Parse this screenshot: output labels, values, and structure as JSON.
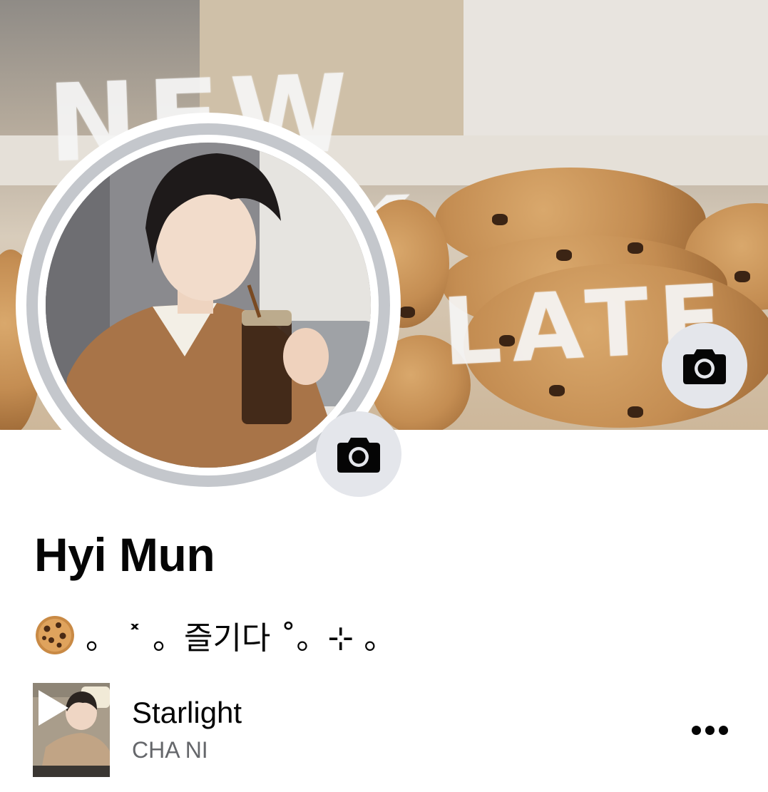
{
  "profile": {
    "name": "Hyi Mun",
    "bio": "。 ˟ 。즐기다 ˚。⊹ 。",
    "bio_icon": "cookie-emoji"
  },
  "cover_photo": {
    "lettering_line1": "NEW YORK",
    "lettering_line2": "LATE"
  },
  "music": {
    "title": "Starlight",
    "artist": "CHA NI",
    "thumb_icon": "play-icon"
  },
  "actions": {
    "cover_camera_icon": "camera-icon",
    "avatar_camera_icon": "camera-icon",
    "more_icon": "more-icon"
  },
  "colors": {
    "button_bg": "#e4e6eb",
    "ring": "#c4c7cc",
    "text_primary": "#050505",
    "text_secondary": "#65676b"
  }
}
